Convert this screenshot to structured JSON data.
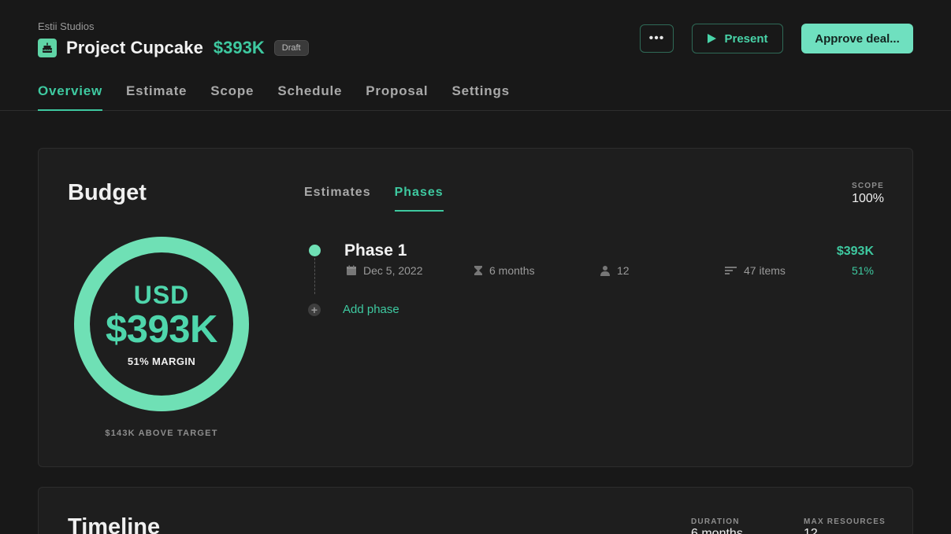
{
  "header": {
    "org": "Estii Studios",
    "title": "Project Cupcake",
    "amount": "$393K",
    "status": "Draft",
    "more_label": "•••",
    "present_label": "Present",
    "approve_label": "Approve deal..."
  },
  "tabs": [
    {
      "label": "Overview",
      "active": true
    },
    {
      "label": "Estimate",
      "active": false
    },
    {
      "label": "Scope",
      "active": false
    },
    {
      "label": "Schedule",
      "active": false
    },
    {
      "label": "Proposal",
      "active": false
    },
    {
      "label": "Settings",
      "active": false
    }
  ],
  "budget": {
    "title": "Budget",
    "currency": "USD",
    "total": "$393K",
    "margin": "51% MARGIN",
    "margin_fraction": 1.0,
    "above_target": "$143K ABOVE TARGET",
    "sub_tabs": [
      {
        "label": "Estimates",
        "active": false
      },
      {
        "label": "Phases",
        "active": true
      }
    ],
    "scope_label": "SCOPE",
    "scope_value": "100%",
    "phases": [
      {
        "name": "Phase 1",
        "date": "Dec 5, 2022",
        "duration": "6 months",
        "people": "12",
        "items": "47 items",
        "amount": "$393K",
        "percent": "51%"
      }
    ],
    "add_phase_label": "Add phase"
  },
  "timeline": {
    "title": "Timeline",
    "duration_label": "DURATION",
    "duration_value": "6 months",
    "resources_label": "MAX RESOURCES",
    "resources_value": "12"
  },
  "colors": {
    "accent": "#3ec9a0",
    "ring": "#6fe0b5",
    "background": "#181818",
    "card": "#1e1e1e"
  }
}
